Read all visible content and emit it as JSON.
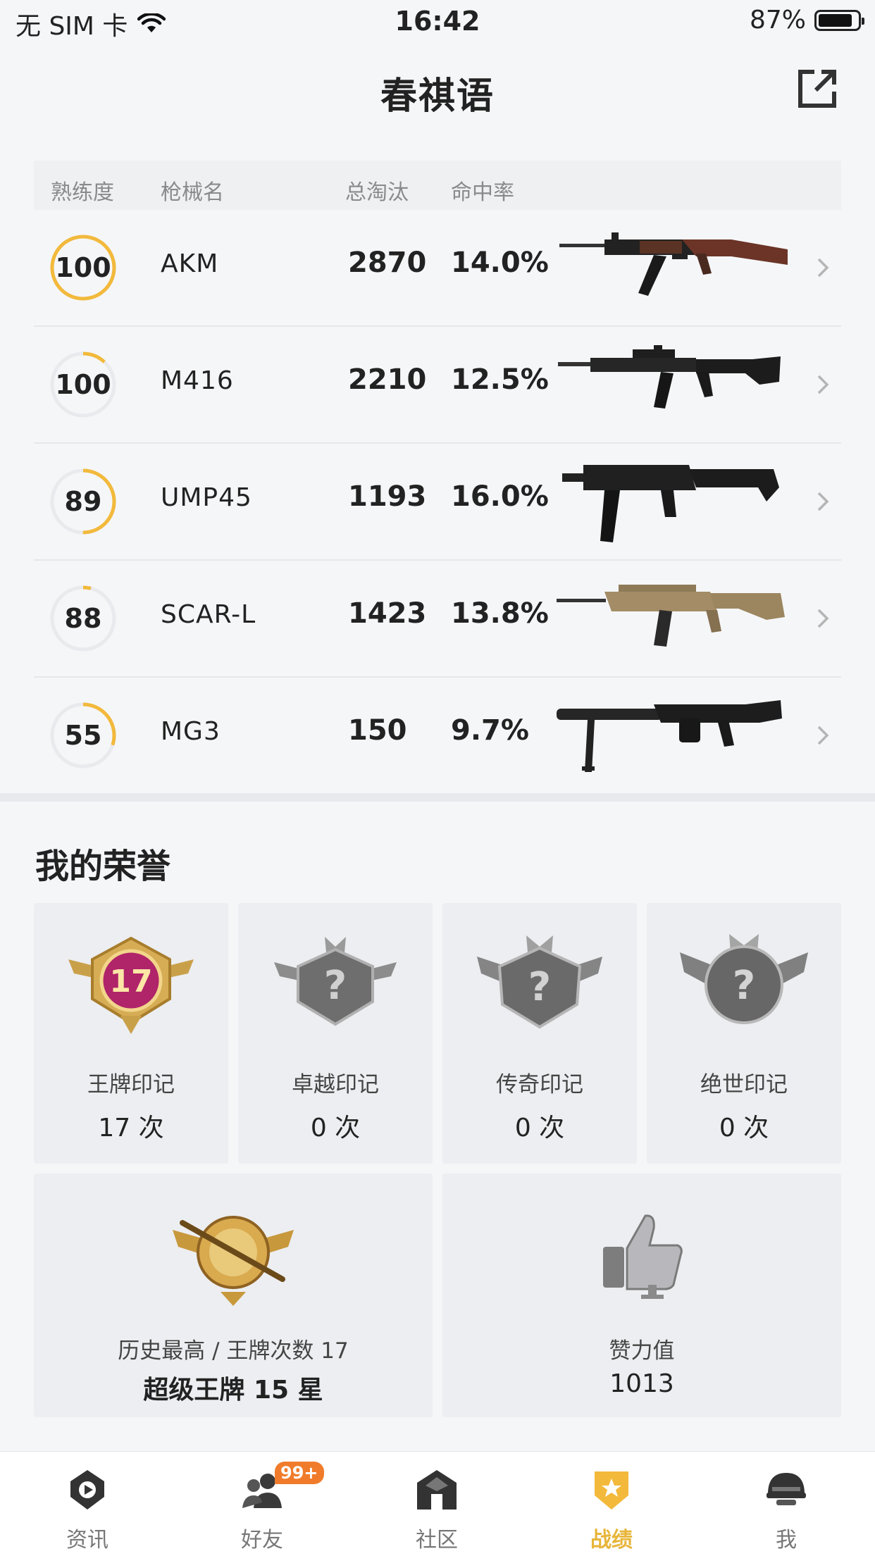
{
  "status_bar": {
    "carrier": "无 SIM 卡",
    "time": "16:42",
    "battery": "87%",
    "battery_level": 0.87
  },
  "header": {
    "title": "春祺语"
  },
  "weapons_table": {
    "headers": [
      "熟练度",
      "枪械名",
      "总淘汰",
      "命中率"
    ],
    "rows": [
      {
        "proficiency": "100",
        "progress": 1.0,
        "name": "AKM",
        "kills": "2870",
        "hit_rate": "14.0%"
      },
      {
        "proficiency": "100",
        "progress": 0.12,
        "name": "M416",
        "kills": "2210",
        "hit_rate": "12.5%"
      },
      {
        "proficiency": "89",
        "progress": 0.5,
        "name": "UMP45",
        "kills": "1193",
        "hit_rate": "16.0%"
      },
      {
        "proficiency": "88",
        "progress": 0.04,
        "name": "SCAR-L",
        "kills": "1423",
        "hit_rate": "13.8%"
      },
      {
        "proficiency": "55",
        "progress": 0.3,
        "name": "MG3",
        "kills": "150",
        "hit_rate": "9.7%"
      }
    ]
  },
  "honors": {
    "title": "我的荣誉",
    "marks": [
      {
        "label": "王牌印记",
        "value": "17 次",
        "badge_number": "17"
      },
      {
        "label": "卓越印记",
        "value": "0 次"
      },
      {
        "label": "传奇印记",
        "value": "0 次"
      },
      {
        "label": "绝世印记",
        "value": "0 次"
      }
    ],
    "highest": {
      "label": "历史最高 / 王牌次数 17",
      "value": "超级王牌 15 星"
    },
    "likes": {
      "label": "赞力值",
      "value": "1013"
    }
  },
  "tab_bar": {
    "tabs": [
      {
        "label": "资讯",
        "icon": "news-play-icon"
      },
      {
        "label": "好友",
        "icon": "friends-icon",
        "badge": "99+"
      },
      {
        "label": "社区",
        "icon": "community-icon"
      },
      {
        "label": "战绩",
        "icon": "record-shield-icon",
        "active": true
      },
      {
        "label": "我",
        "icon": "helmet-icon"
      }
    ]
  },
  "colors": {
    "accent": "#f2b93b",
    "active_tab": "#e7b53a",
    "badge": "#f07c2b"
  }
}
